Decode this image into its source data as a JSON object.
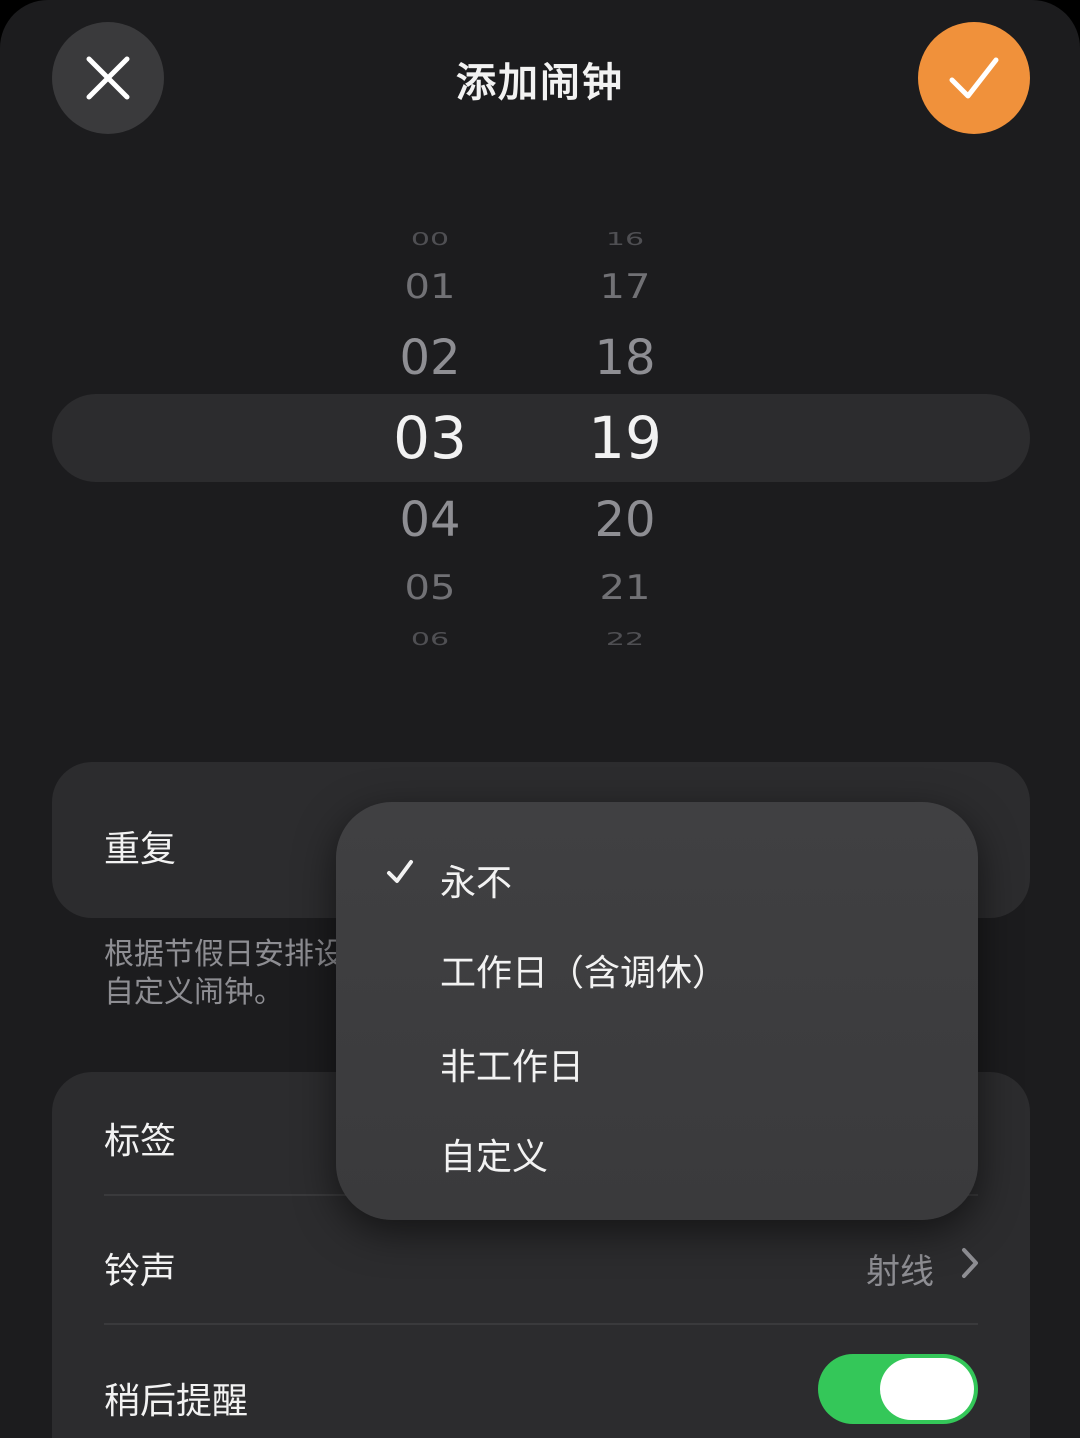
{
  "header": {
    "title": "添加闹钟",
    "close_icon": "close-icon",
    "confirm_icon": "checkmark-icon",
    "confirm_color": "#f0913b"
  },
  "picker": {
    "hours": [
      "00",
      "01",
      "02",
      "03",
      "04",
      "05",
      "06"
    ],
    "minutes": [
      "16",
      "17",
      "18",
      "19",
      "20",
      "21",
      "22"
    ],
    "selected_hour": "03",
    "selected_minute": "19"
  },
  "repeat": {
    "label": "重复",
    "note": "根据节假日安排设\n自定义闹钟。"
  },
  "dropdown": {
    "options": [
      "永不",
      "工作日（含调休）",
      "非工作日",
      "自定义"
    ],
    "selected": "永不"
  },
  "settings": {
    "label_row": "标签",
    "ringtone_row": "铃声",
    "ringtone_value": "射线",
    "snooze_row": "稍后提醒",
    "snooze_enabled": true,
    "toggle_color": "#34c759"
  }
}
